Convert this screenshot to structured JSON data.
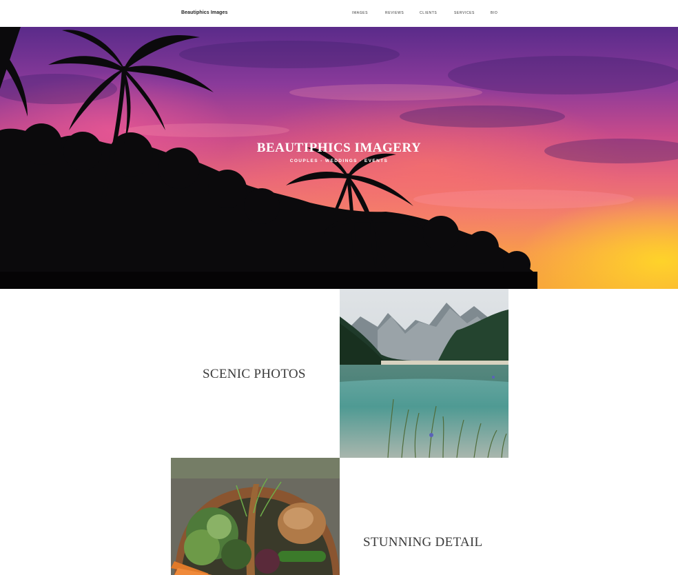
{
  "header": {
    "brand": "Beautiphics Images",
    "nav": [
      "IMAGES",
      "REVIEWS",
      "CLIENTS",
      "SERVICES",
      "BIO"
    ]
  },
  "hero": {
    "title": "BEAUTIPHICS IMAGERY",
    "subtitle": "COUPLES - WEDDINGS - EVENTS"
  },
  "features": [
    {
      "label": "SCENIC PHOTOS"
    },
    {
      "label": "STUNNING DETAIL"
    }
  ],
  "colors": {
    "hero_sky_top": "#5a2b8a",
    "hero_sky_mid": "#e8667a",
    "hero_sun": "#ffd628",
    "text_dark": "#3a3a3a",
    "background": "#ffffff"
  }
}
